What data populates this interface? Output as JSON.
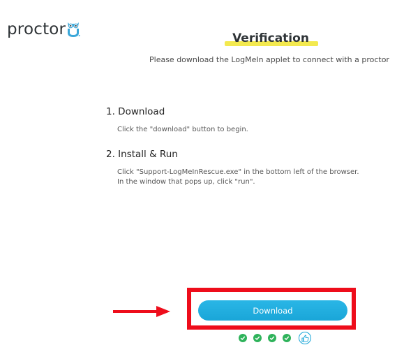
{
  "brand": {
    "name": "proctor",
    "owl_icon": "owl-u-icon",
    "text_color": "#2f3437"
  },
  "header": {
    "title": "Verification",
    "title_highlight_color": "#f3e94f",
    "subtitle": "Please download the LogMeIn applet to connect with a proctor"
  },
  "steps": [
    {
      "heading": "1. Download",
      "lines": [
        "Click the \"download\" button to begin."
      ]
    },
    {
      "heading": "2. Install & Run",
      "lines": [
        "Click \"Support-LogMeInRescue.exe\" in the bottom left of the browser.",
        "In the window that pops up, click \"run\"."
      ]
    }
  ],
  "download_button": {
    "label": "Download",
    "color": "#1aa6d8"
  },
  "annotation": {
    "arrow_color": "#ee0d1b",
    "box_color": "#ee0d1b"
  },
  "progress": {
    "completed_steps": 4,
    "check_color": "#2fb35b",
    "final_icon": "thumbs-up-icon"
  }
}
